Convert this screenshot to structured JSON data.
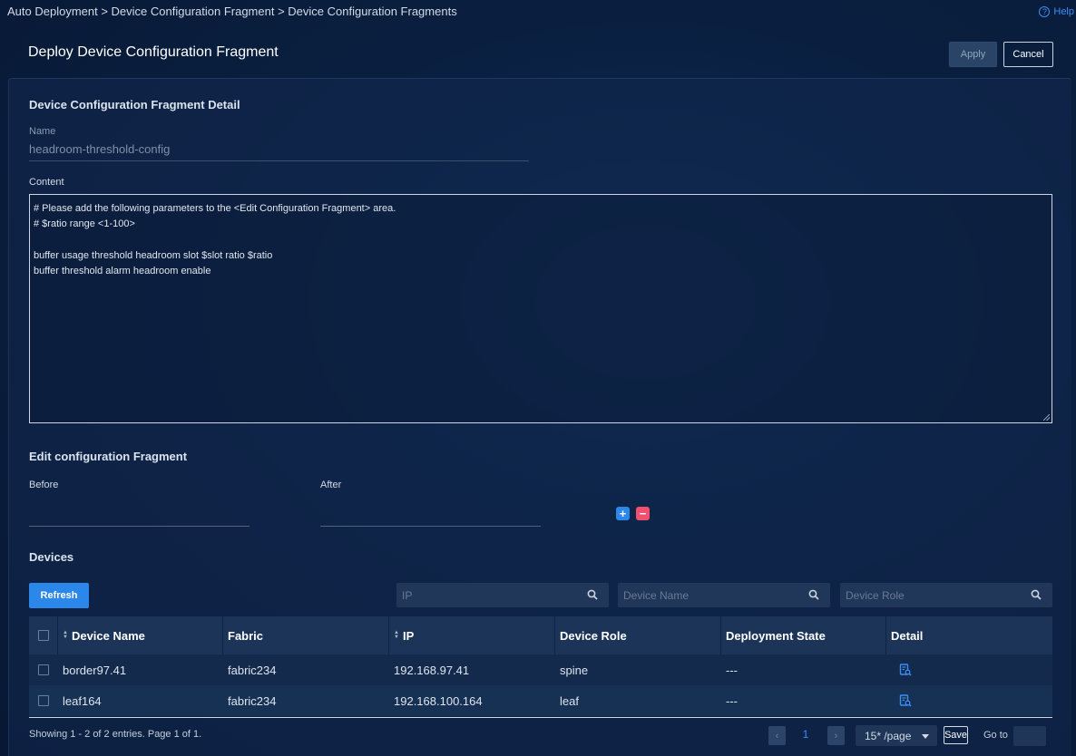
{
  "breadcrumb": "Auto Deployment > Device Configuration Fragment > Device Configuration Fragments",
  "help": {
    "label": "Help"
  },
  "page_title": "Deploy Device Configuration Fragment",
  "actions": {
    "apply": "Apply",
    "cancel": "Cancel"
  },
  "detail": {
    "title": "Device Configuration Fragment Detail",
    "name_label": "Name",
    "name_value": "headroom-threshold-config",
    "content_label": "Content",
    "content_lines": [
      "# Please add the following parameters to the <Edit Configuration Fragment> area.",
      "# $ratio range <1-100>",
      "",
      "buffer usage threshold headroom slot $slot ratio $ratio",
      "buffer threshold alarm headroom enable"
    ]
  },
  "edit": {
    "title": "Edit configuration Fragment",
    "before_label": "Before",
    "after_label": "After",
    "add_symbol": "+",
    "remove_symbol": "−"
  },
  "devices": {
    "title": "Devices",
    "refresh": "Refresh",
    "search": {
      "ip_placeholder": "IP",
      "name_placeholder": "Device Name",
      "role_placeholder": "Device Role"
    },
    "columns": {
      "name": "Device Name",
      "fabric": "Fabric",
      "ip": "IP",
      "role": "Device Role",
      "state": "Deployment State",
      "detail": "Detail"
    },
    "rows": [
      {
        "name": "border97.41",
        "fabric": "fabric234",
        "ip": "192.168.97.41",
        "role": "spine",
        "state": "---"
      },
      {
        "name": "leaf164",
        "fabric": "fabric234",
        "ip": "192.168.100.164",
        "role": "leaf",
        "state": "---"
      }
    ]
  },
  "pagination": {
    "summary": "Showing 1 - 2 of 2 entries. Page 1 of 1.",
    "prev": "‹",
    "next": "›",
    "current_page": "1",
    "page_size": "15* /page",
    "save": "Save",
    "goto_label": "Go to"
  },
  "colors": {
    "accent": "#2c87ea",
    "danger": "#f0506e",
    "background": "#0a1f40"
  }
}
